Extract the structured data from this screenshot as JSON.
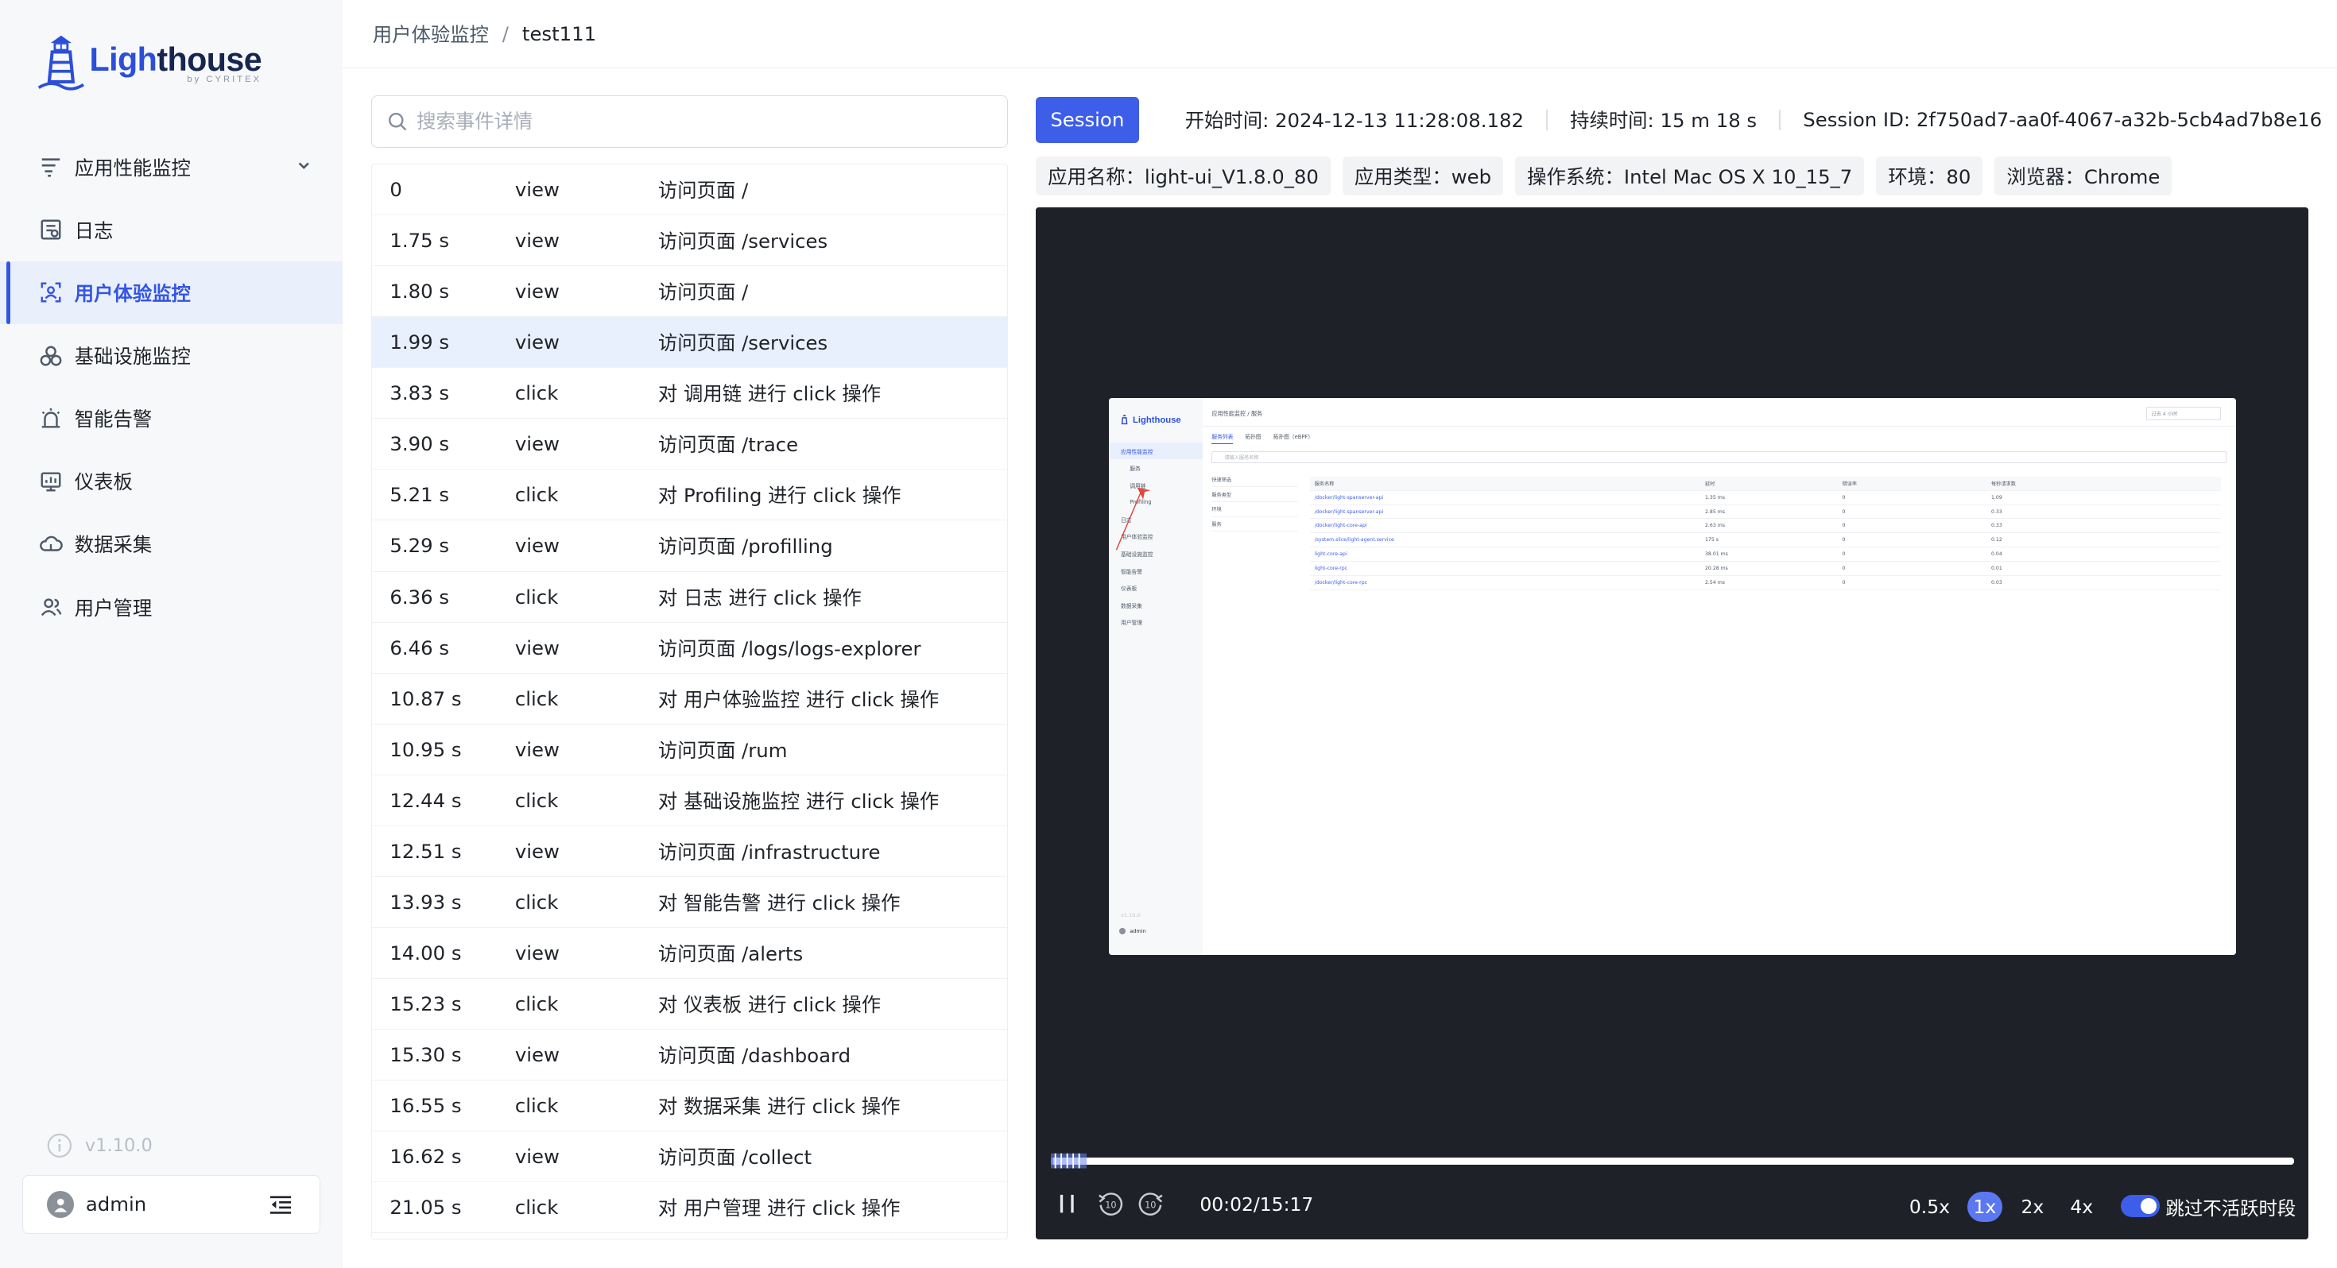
{
  "app": {
    "logo_word_a": "Ligh",
    "logo_word_b": "thouse",
    "logo_subtitle": "by CYRITEX"
  },
  "colors": {
    "accent": "#3d5ee8",
    "player_bg": "#1e2128",
    "selected_row": "#e8f0fd"
  },
  "sidebar": {
    "items": [
      {
        "label": "应用性能监控",
        "icon": "apm-icon",
        "has_chevron": true
      },
      {
        "label": "日志",
        "icon": "log-icon"
      },
      {
        "label": "用户体验监控",
        "icon": "user-experience-icon",
        "active": true
      },
      {
        "label": "基础设施监控",
        "icon": "infrastructure-icon"
      },
      {
        "label": "智能告警",
        "icon": "alert-icon"
      },
      {
        "label": "仪表板",
        "icon": "dashboard-icon"
      },
      {
        "label": "数据采集",
        "icon": "collect-icon"
      },
      {
        "label": "用户管理",
        "icon": "users-icon"
      }
    ],
    "version": "v1.10.0",
    "user": "admin"
  },
  "breadcrumb": {
    "parent": "用户体验监控",
    "separator": "/",
    "current": "test111"
  },
  "search": {
    "placeholder": "搜索事件详情",
    "value": ""
  },
  "events": {
    "selected_index": 3,
    "rows": [
      {
        "time": "0",
        "type": "view",
        "desc": "访问页面 /"
      },
      {
        "time": "1.75 s",
        "type": "view",
        "desc": "访问页面 /services"
      },
      {
        "time": "1.80 s",
        "type": "view",
        "desc": "访问页面 /"
      },
      {
        "time": "1.99 s",
        "type": "view",
        "desc": "访问页面 /services"
      },
      {
        "time": "3.83 s",
        "type": "click",
        "desc": "对 调用链 进行 click 操作"
      },
      {
        "time": "3.90 s",
        "type": "view",
        "desc": "访问页面 /trace"
      },
      {
        "time": "5.21 s",
        "type": "click",
        "desc": "对 Profiling 进行 click 操作"
      },
      {
        "time": "5.29 s",
        "type": "view",
        "desc": "访问页面 /profilling"
      },
      {
        "time": "6.36 s",
        "type": "click",
        "desc": "对 日志 进行 click 操作"
      },
      {
        "time": "6.46 s",
        "type": "view",
        "desc": "访问页面 /logs/logs-explorer"
      },
      {
        "time": "10.87 s",
        "type": "click",
        "desc": "对 用户体验监控 进行 click 操作"
      },
      {
        "time": "10.95 s",
        "type": "view",
        "desc": "访问页面 /rum"
      },
      {
        "time": "12.44 s",
        "type": "click",
        "desc": "对 基础设施监控 进行 click 操作"
      },
      {
        "time": "12.51 s",
        "type": "view",
        "desc": "访问页面 /infrastructure"
      },
      {
        "time": "13.93 s",
        "type": "click",
        "desc": "对 智能告警 进行 click 操作"
      },
      {
        "time": "14.00 s",
        "type": "view",
        "desc": "访问页面 /alerts"
      },
      {
        "time": "15.23 s",
        "type": "click",
        "desc": "对 仪表板 进行 click 操作"
      },
      {
        "time": "15.30 s",
        "type": "view",
        "desc": "访问页面 /dashboard"
      },
      {
        "time": "16.55 s",
        "type": "click",
        "desc": "对 数据采集 进行 click 操作"
      },
      {
        "time": "16.62 s",
        "type": "view",
        "desc": "访问页面 /collect"
      },
      {
        "time": "21.05 s",
        "type": "click",
        "desc": "对 用户管理 进行 click 操作"
      }
    ]
  },
  "session": {
    "badge": "Session",
    "start_time": "开始时间: 2024-12-13 11:28:08.182",
    "duration": "持续时间: 15 m 18 s",
    "session_id": "Session ID: 2f750ad7-aa0f-4067-a32b-5cb4ad7b8e16",
    "tags": [
      "应用名称：light-ui_V1.8.0_80",
      "应用类型：web",
      "操作系统：Intel Mac OS X 10_15_7",
      "环境：80",
      "浏览器：Chrome"
    ]
  },
  "player": {
    "current_time": "00:02/15:17",
    "progress": 0.002,
    "speeds": [
      "0.5x",
      "1x",
      "2x",
      "4x"
    ],
    "active_speed": "1x",
    "skip_inactive_label": "跳过不活跃时段",
    "skip_inactive_enabled": true
  },
  "replay": {
    "logo": "Lighthouse",
    "breadcrumb": "应用性能监控 / 服务",
    "top_right": "过去 4 小时",
    "tabs": [
      "服务列表",
      "拓扑图",
      "拓扑图（eBPF）"
    ],
    "search_placeholder": "请输入服务名称",
    "filter_title": "快速筛选",
    "filters": [
      "服务类型",
      "环境",
      "服务"
    ],
    "nav": [
      "应用性能监控",
      "服务",
      "调用链",
      "Profiling",
      "日志",
      "用户体验监控",
      "基础设施监控",
      "智能告警",
      "仪表板",
      "数据采集",
      "用户管理"
    ],
    "nav_version": "v1.10.0",
    "nav_user": "admin",
    "table_head": [
      "服务名称",
      "延时",
      "错误率",
      "每秒请求数"
    ],
    "table_rows": [
      [
        "/docker/light-spanserver-api",
        "1.35 ms",
        "0",
        "1.09"
      ],
      [
        "/docker/light-spanserver-api",
        "2.85 ms",
        "0",
        "0.33"
      ],
      [
        "/docker/light-core-api",
        "2.63 ms",
        "0",
        "0.33"
      ],
      [
        "/system.slice/light-agent.service",
        "175 s",
        "0",
        "0.12"
      ],
      [
        "light-core-api",
        "38.01 ms",
        "0",
        "0.04"
      ],
      [
        "light-core-rpc",
        "20.28 ms",
        "0",
        "0.01"
      ],
      [
        "/docker/light-core-rpc",
        "2.54 ms",
        "0",
        "0.03"
      ]
    ]
  }
}
